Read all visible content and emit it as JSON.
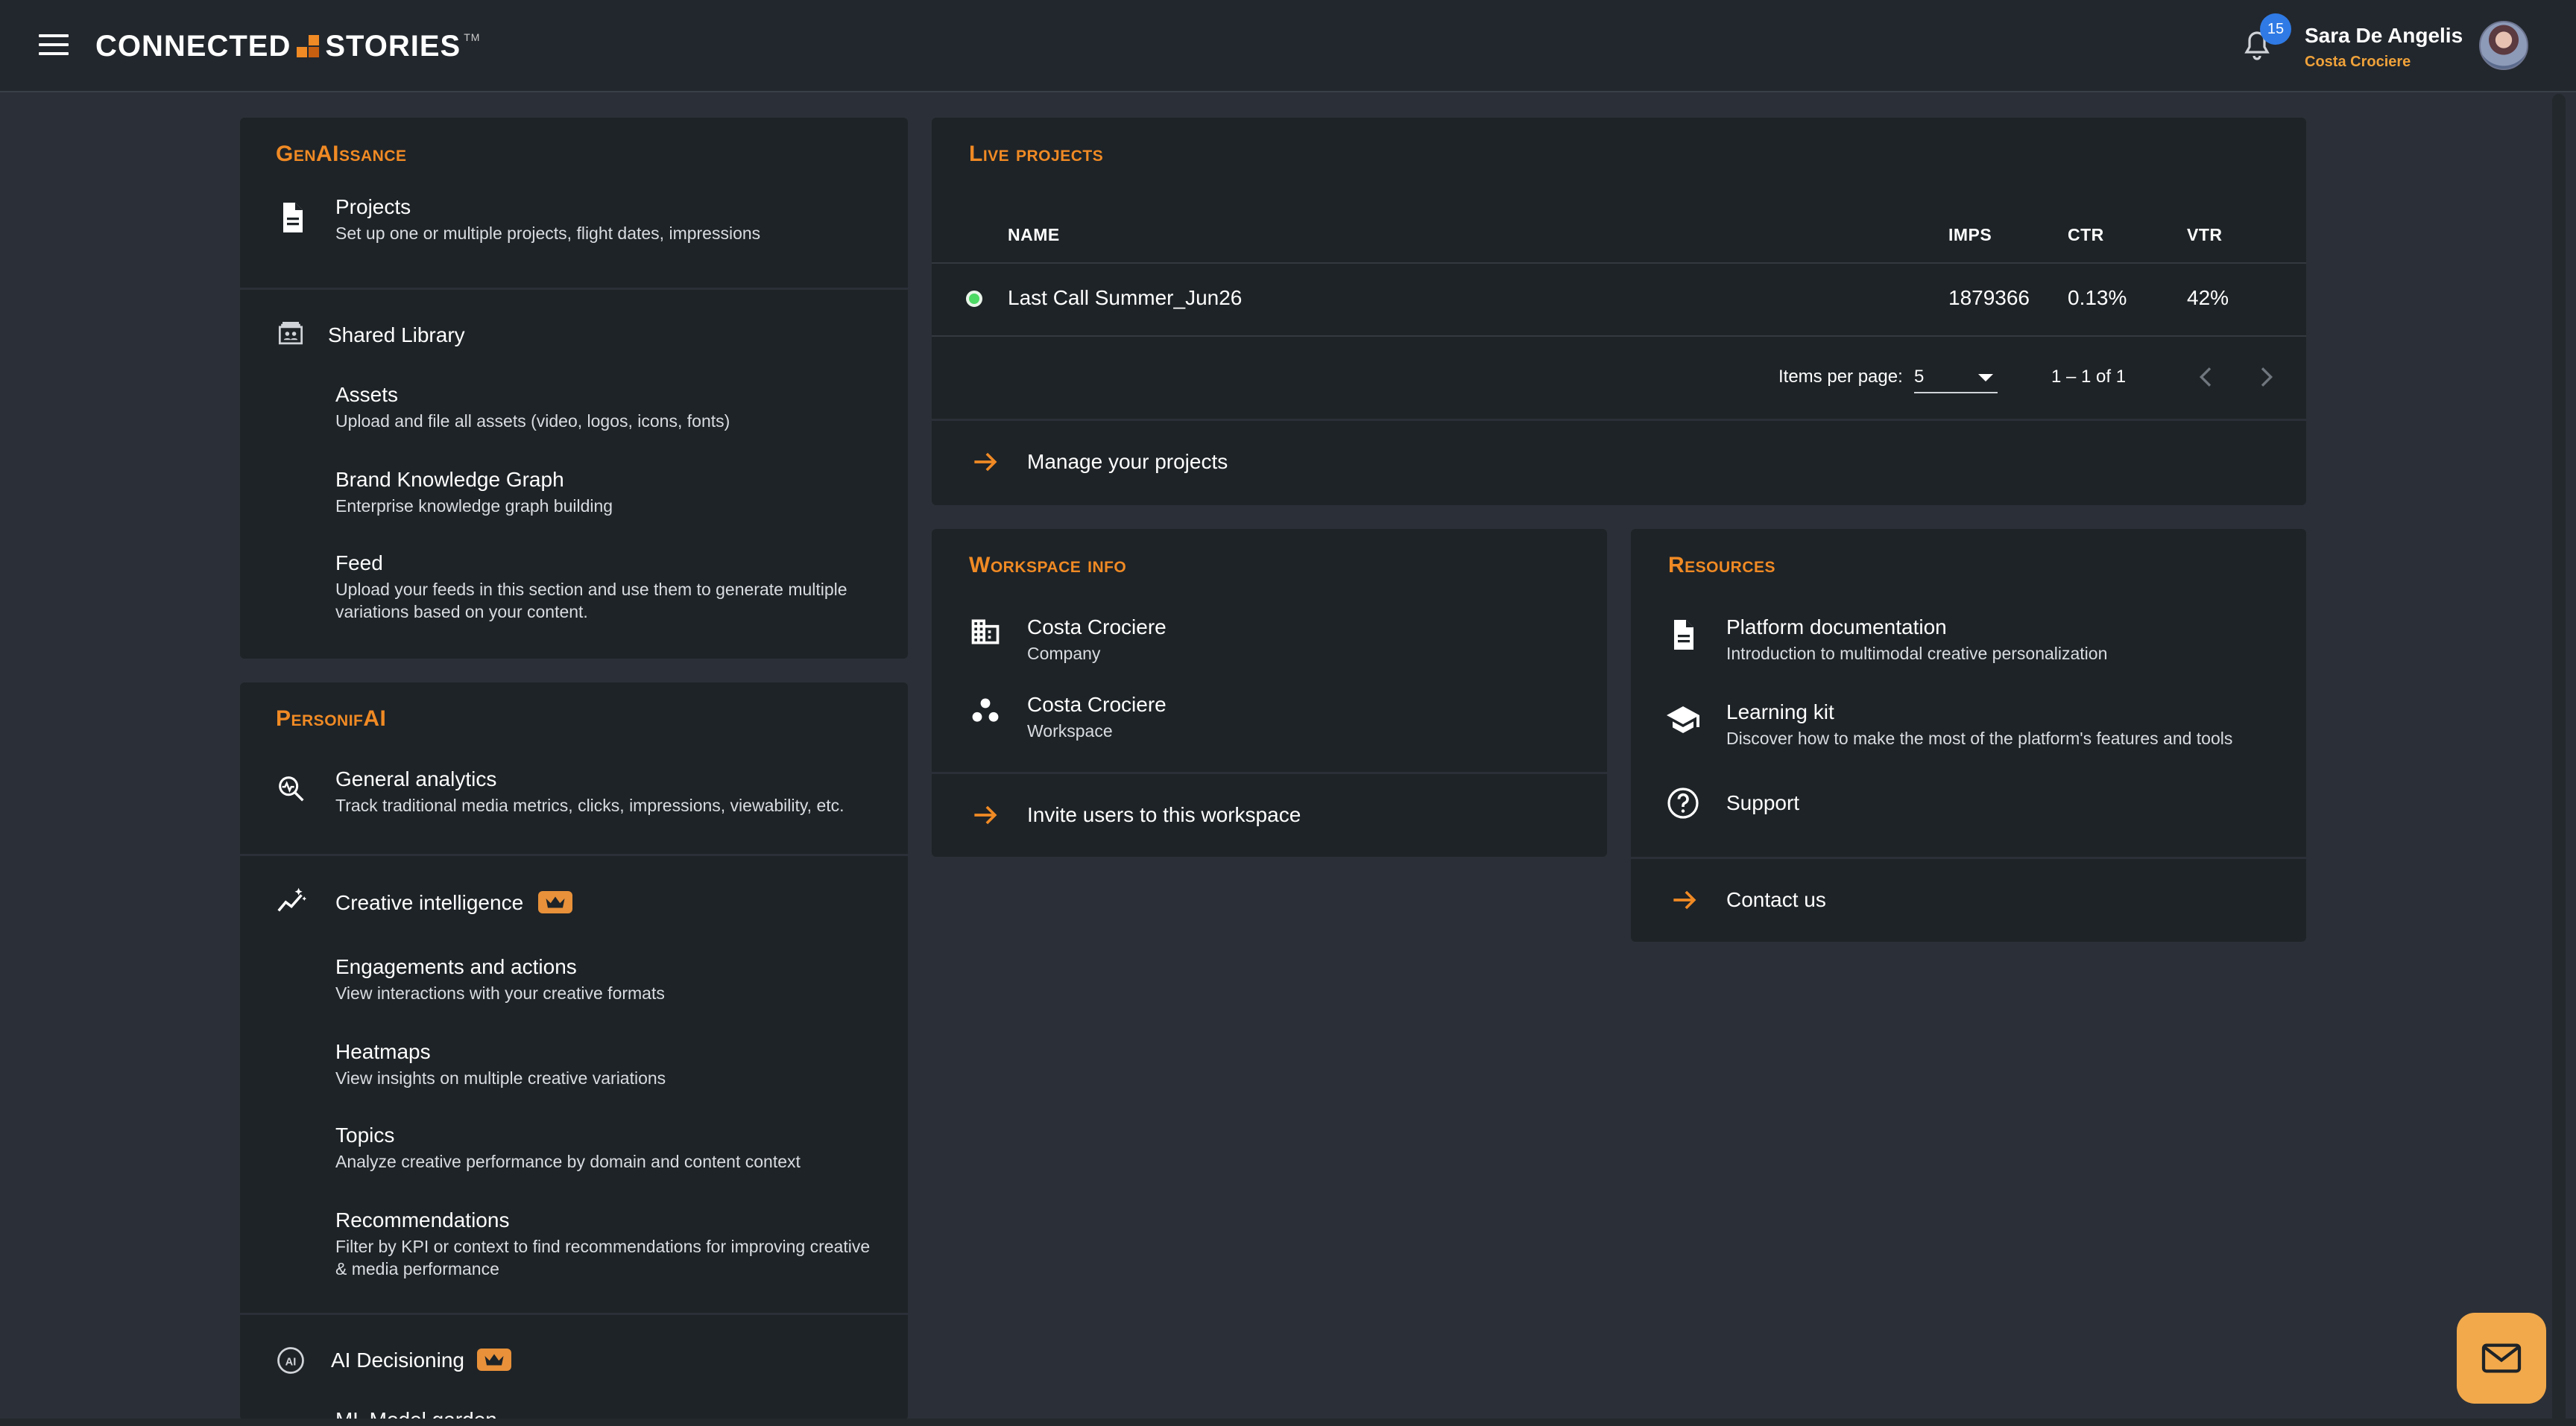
{
  "header": {
    "logo_left": "CONNECTED",
    "logo_right": "STORIES",
    "logo_tm": "TM",
    "notification_count": "15",
    "user_name": "Sara De Angelis",
    "user_company": "Costa Crociere"
  },
  "genaissance": {
    "title": "GenAIssance",
    "projects": {
      "title": "Projects",
      "sub": "Set up one or multiple projects, flight dates, impressions"
    },
    "shared_library": "Shared Library",
    "assets": {
      "title": "Assets",
      "sub": "Upload and file all assets (video, logos, icons, fonts)"
    },
    "brand_graph": {
      "title": "Brand Knowledge Graph",
      "sub": "Enterprise knowledge graph building"
    },
    "feed": {
      "title": "Feed",
      "sub": "Upload your feeds in this section and use them to generate multiple variations based on your content."
    }
  },
  "personifai": {
    "title": "PersonifAI",
    "general_analytics": {
      "title": "General analytics",
      "sub": "Track traditional media metrics, clicks, impressions, viewability, etc."
    },
    "creative_intelligence": "Creative intelligence",
    "engagements": {
      "title": "Engagements and actions",
      "sub": "View interactions with your creative formats"
    },
    "heatmaps": {
      "title": "Heatmaps",
      "sub": "View insights on multiple creative variations"
    },
    "topics": {
      "title": "Topics",
      "sub": "Analyze creative performance by domain and content context"
    },
    "recommendations": {
      "title": "Recommendations",
      "sub": "Filter by KPI or context to find recommendations for improving creative & media performance"
    },
    "ai_decisioning": "AI Decisioning",
    "ml_model_garden": "ML Model garden"
  },
  "live_projects": {
    "title": "Live projects",
    "columns": {
      "name": "NAME",
      "imps": "IMPS",
      "ctr": "CTR",
      "vtr": "VTR"
    },
    "rows": [
      {
        "name": "Last Call Summer_Jun26",
        "imps": "1879366",
        "ctr": "0.13%",
        "vtr": "42%"
      }
    ],
    "items_per_page_label": "Items per page:",
    "items_per_page_value": "5",
    "range_label": "1 – 1 of 1",
    "manage_label": "Manage your projects"
  },
  "workspace_info": {
    "title": "Workspace info",
    "company": {
      "title": "Costa Crociere",
      "sub": "Company"
    },
    "workspace": {
      "title": "Costa Crociere",
      "sub": "Workspace"
    },
    "invite_label": "Invite users to this workspace"
  },
  "resources": {
    "title": "Resources",
    "docs": {
      "title": "Platform documentation",
      "sub": "Introduction to multimodal creative personalization"
    },
    "learning": {
      "title": "Learning kit",
      "sub": "Discover how to make the most of the platform's features and tools"
    },
    "support": "Support",
    "contact": "Contact us"
  },
  "colors": {
    "accent": "#f08a24",
    "background": "#2b3038",
    "card": "#1e2327",
    "status_live": "#4cd964",
    "badge": "#2f7ae5"
  }
}
